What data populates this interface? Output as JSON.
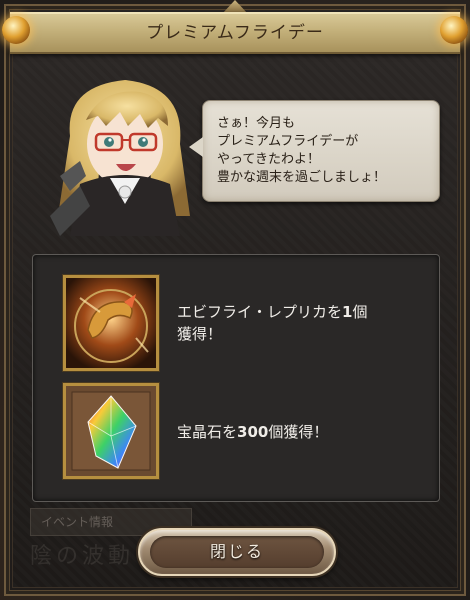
{
  "dialog": {
    "title": "プレミアムフライデー"
  },
  "speech": {
    "lines": [
      "さぁ！今月も",
      "プレミアムフライデーが",
      "やってきたわよ！",
      "豊かな週末を過ごしましょ！"
    ]
  },
  "rewards": [
    {
      "icon": "ebi-fry-replica-icon",
      "text_before": "エビフライ・レプリカを",
      "count": "1",
      "text_after": "個",
      "line2": "獲得！"
    },
    {
      "icon": "prism-crystal-icon",
      "text_before": "宝晶石を",
      "count": "300",
      "text_after": "個獲得！"
    }
  ],
  "background": {
    "banner": "イベント情報",
    "ghost_text": "陰の波動"
  },
  "close_button": {
    "label": "閉じる"
  },
  "colors": {
    "title_bar": "#c3b07a",
    "panel_bg": "#2a2827",
    "icon_frame": "#b68f3f",
    "button": "#6d5440"
  }
}
